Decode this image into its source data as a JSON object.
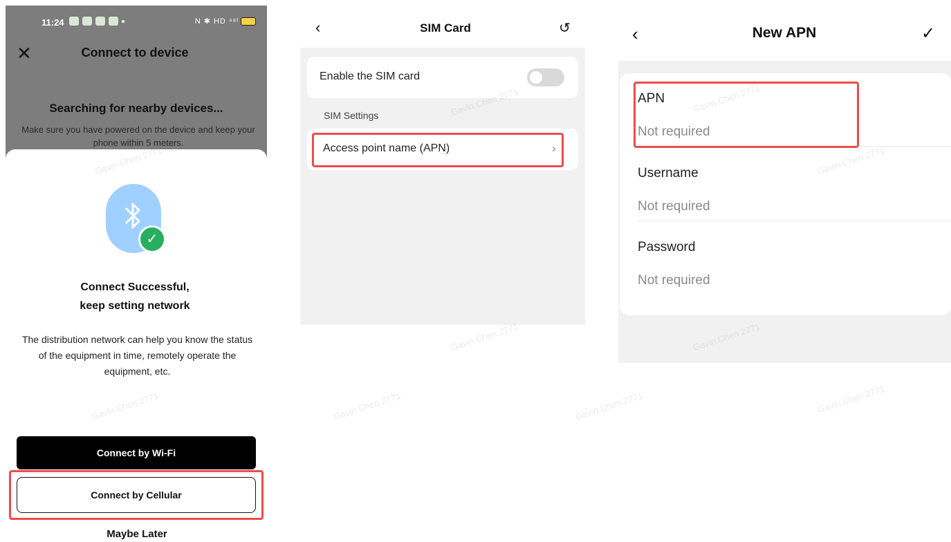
{
  "panel1": {
    "status": {
      "time": "11:24",
      "right_icons": "N ✱ HD ⁴⁶ᴵ"
    },
    "header": {
      "title": "Connect to device"
    },
    "background": {
      "searching": "Searching for nearby devices...",
      "hint": "Make sure you have powered on the device and keep your phone within 5 meters."
    },
    "sheet": {
      "success_line1": "Connect Successful,",
      "success_line2": "keep setting network",
      "description": "The distribution network can help you know the status of the equipment in time, remotely operate the equipment, etc.",
      "wifi_button": "Connect by Wi-Fi",
      "cellular_button": "Connect by Cellular",
      "later_button": "Maybe Later"
    }
  },
  "panel2": {
    "header": {
      "title": "SIM Card"
    },
    "enable_label": "Enable the SIM card",
    "enable_state": false,
    "section_title": "SIM Settings",
    "apn_item": "Access point name (APN)"
  },
  "panel3": {
    "header": {
      "title": "New APN"
    },
    "fields": [
      {
        "label": "APN",
        "value": "Not required"
      },
      {
        "label": "Username",
        "value": "Not required"
      },
      {
        "label": "Password",
        "value": "Not required"
      }
    ]
  },
  "watermark": "Gavin.Chen 2771",
  "colors": {
    "highlight": "#ee4b4b",
    "primary_button": "#000000",
    "check_green": "#27ae60",
    "bt_blue": "#9fd0ff"
  }
}
